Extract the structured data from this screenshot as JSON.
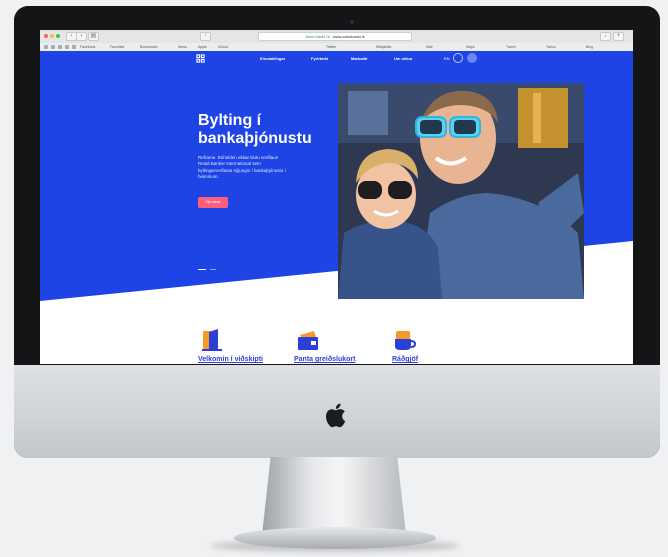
{
  "browser": {
    "url": "www.arionbanki.is",
    "secure_label": "Arion banki hf.",
    "bookmarks": [
      "Facebook",
      "Favorites",
      "Bookmarks",
      "News",
      "Apple",
      "iCloud",
      "Twitter",
      "Wikipedia",
      "Mail",
      "Maps",
      "Travel",
      "Yahoo",
      "Bing"
    ]
  },
  "site": {
    "nav": [
      "Einstaklingar",
      "Fyrirtæki",
      "Markaðir",
      "Um okkur"
    ],
    "lang": "EN",
    "hero": {
      "title": "Bylting í bankaþjónustu",
      "text": "Reframe. Búhelden ekkar klutu verðlaun Retail Banker International sem byltingarverðasta nýjungin í bankaþjónustu í heiminum.",
      "button": "Sjá nánar"
    },
    "features": [
      {
        "label": "Velkomin í viðskipti",
        "icon": "door-icon"
      },
      {
        "label": "Panta greiðslukort",
        "icon": "wallet-icon"
      },
      {
        "label": "Ráðgjöf",
        "icon": "coffee-cup-icon"
      }
    ]
  },
  "colors": {
    "brand_blue": "#1f44e6",
    "cta_pink": "#ff5e7a",
    "feature_blue": "#2c3fd6",
    "accent_orange": "#f59a28"
  }
}
